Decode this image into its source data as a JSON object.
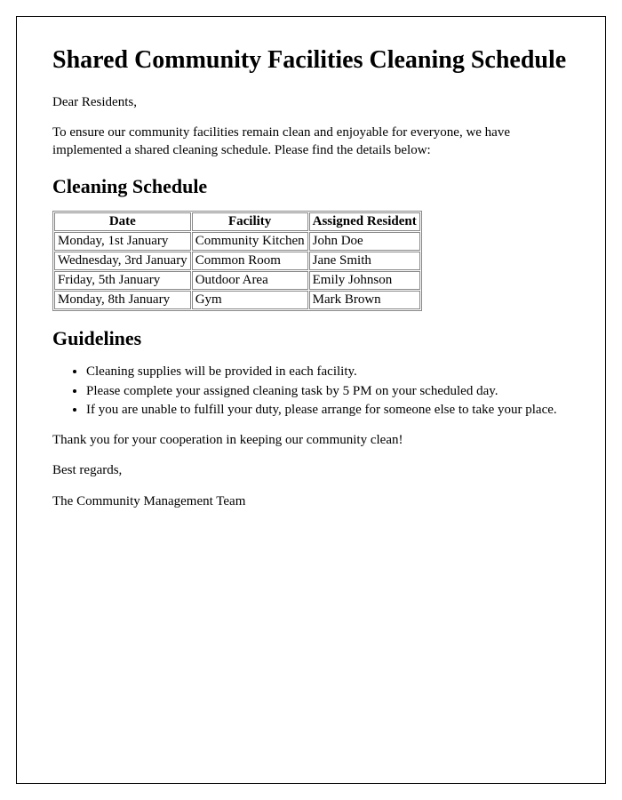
{
  "title": "Shared Community Facilities Cleaning Schedule",
  "greeting": "Dear Residents,",
  "intro": "To ensure our community facilities remain clean and enjoyable for everyone, we have implemented a shared cleaning schedule. Please find the details below:",
  "schedule_heading": "Cleaning Schedule",
  "table": {
    "headers": [
      "Date",
      "Facility",
      "Assigned Resident"
    ],
    "rows": [
      [
        "Monday, 1st January",
        "Community Kitchen",
        "John Doe"
      ],
      [
        "Wednesday, 3rd January",
        "Common Room",
        "Jane Smith"
      ],
      [
        "Friday, 5th January",
        "Outdoor Area",
        "Emily Johnson"
      ],
      [
        "Monday, 8th January",
        "Gym",
        "Mark Brown"
      ]
    ]
  },
  "guidelines_heading": "Guidelines",
  "guidelines": [
    "Cleaning supplies will be provided in each facility.",
    "Please complete your assigned cleaning task by 5 PM on your scheduled day.",
    "If you are unable to fulfill your duty, please arrange for someone else to take your place."
  ],
  "thanks": "Thank you for your cooperation in keeping our community clean!",
  "regards": "Best regards,",
  "signature": "The Community Management Team"
}
